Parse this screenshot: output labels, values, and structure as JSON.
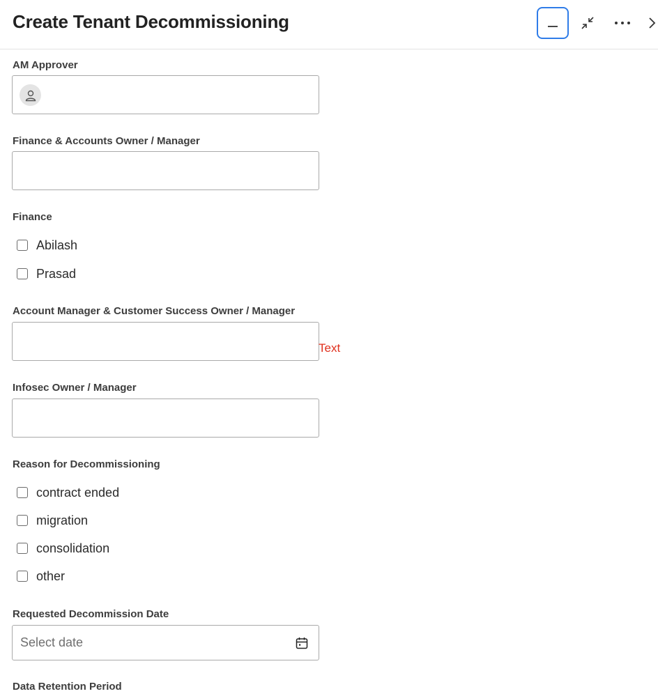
{
  "header": {
    "title": "Create Tenant Decommissioning"
  },
  "form": {
    "am_approver": {
      "label": "AM Approver"
    },
    "finance_accounts_owner": {
      "label": "Finance & Accounts Owner / Manager"
    },
    "finance": {
      "label": "Finance",
      "options": [
        "Abilash",
        "Prasad"
      ]
    },
    "account_manager_owner": {
      "label": "Account Manager & Customer Success Owner / Manager",
      "side_text": "Text"
    },
    "infosec_owner": {
      "label": "Infosec Owner / Manager"
    },
    "reason": {
      "label": "Reason for Decommissioning",
      "options": [
        "contract ended",
        "migration",
        "consolidation",
        "other"
      ]
    },
    "requested_date": {
      "label": "Requested Decommission Date",
      "placeholder": "Select date"
    },
    "retention": {
      "label": "Data Retention Period"
    }
  },
  "icons": {
    "minimize": "minimize-icon",
    "collapse": "collapse-icon",
    "more": "more-icon",
    "close": "chevron-right-icon",
    "avatar": "person-icon",
    "calendar": "calendar-icon"
  },
  "colors": {
    "focus_border": "#2f7ce8",
    "error_text": "#e0301e",
    "field_border": "#a9a9a9"
  }
}
